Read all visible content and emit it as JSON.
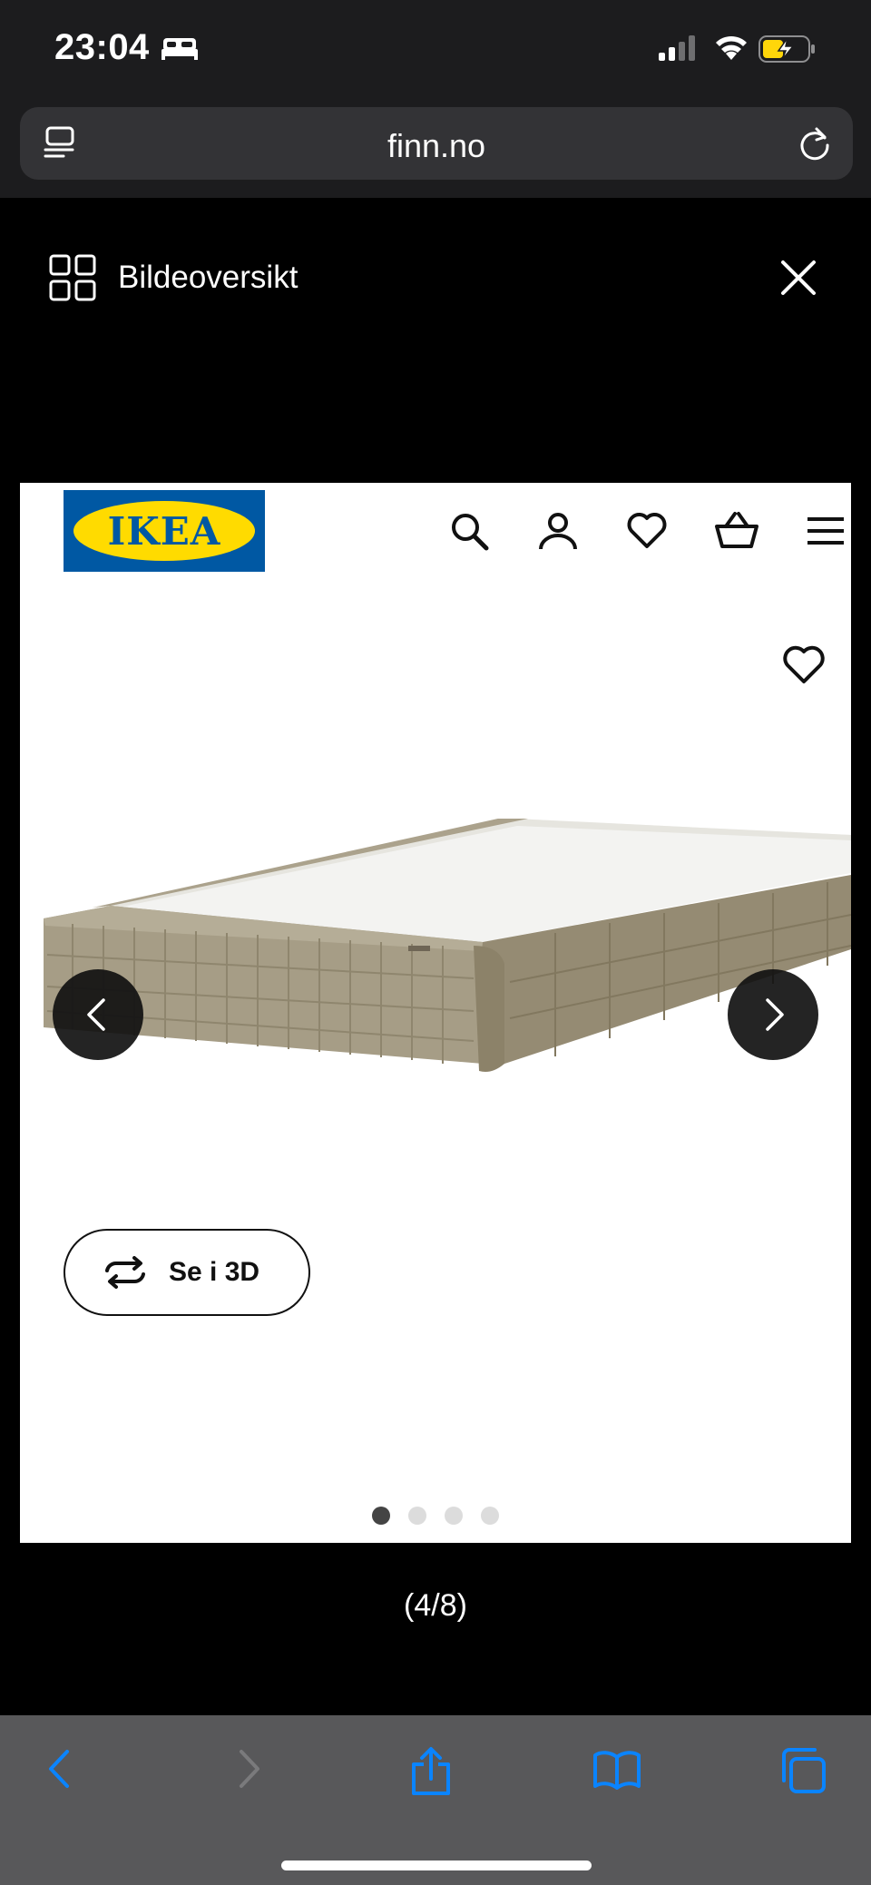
{
  "status_bar": {
    "time": "23:04",
    "icons": [
      "bed-icon",
      "cellular-signal-icon",
      "wifi-icon",
      "battery-charging-icon"
    ]
  },
  "browser": {
    "url": "finn.no",
    "icons": [
      "reader-icon",
      "reload-icon"
    ]
  },
  "viewer": {
    "overview_label": "Bildeoversikt",
    "counter": "(4/8)"
  },
  "image": {
    "brand": "IKEA",
    "nav_icons": [
      "search-icon",
      "profile-icon",
      "heart-icon",
      "basket-icon",
      "menu-icon"
    ],
    "view_3d_label": "Se i 3D",
    "dots": {
      "count": 4,
      "active": 0
    }
  },
  "toolbar": {
    "icons": [
      "back-icon",
      "forward-icon",
      "share-icon",
      "bookmarks-icon",
      "tabs-icon"
    ]
  },
  "colors": {
    "ikea_blue": "#0058a3",
    "ikea_yellow": "#ffdb00",
    "ios_blue": "#0a84ff",
    "battery_yellow": "#ffd60a"
  }
}
